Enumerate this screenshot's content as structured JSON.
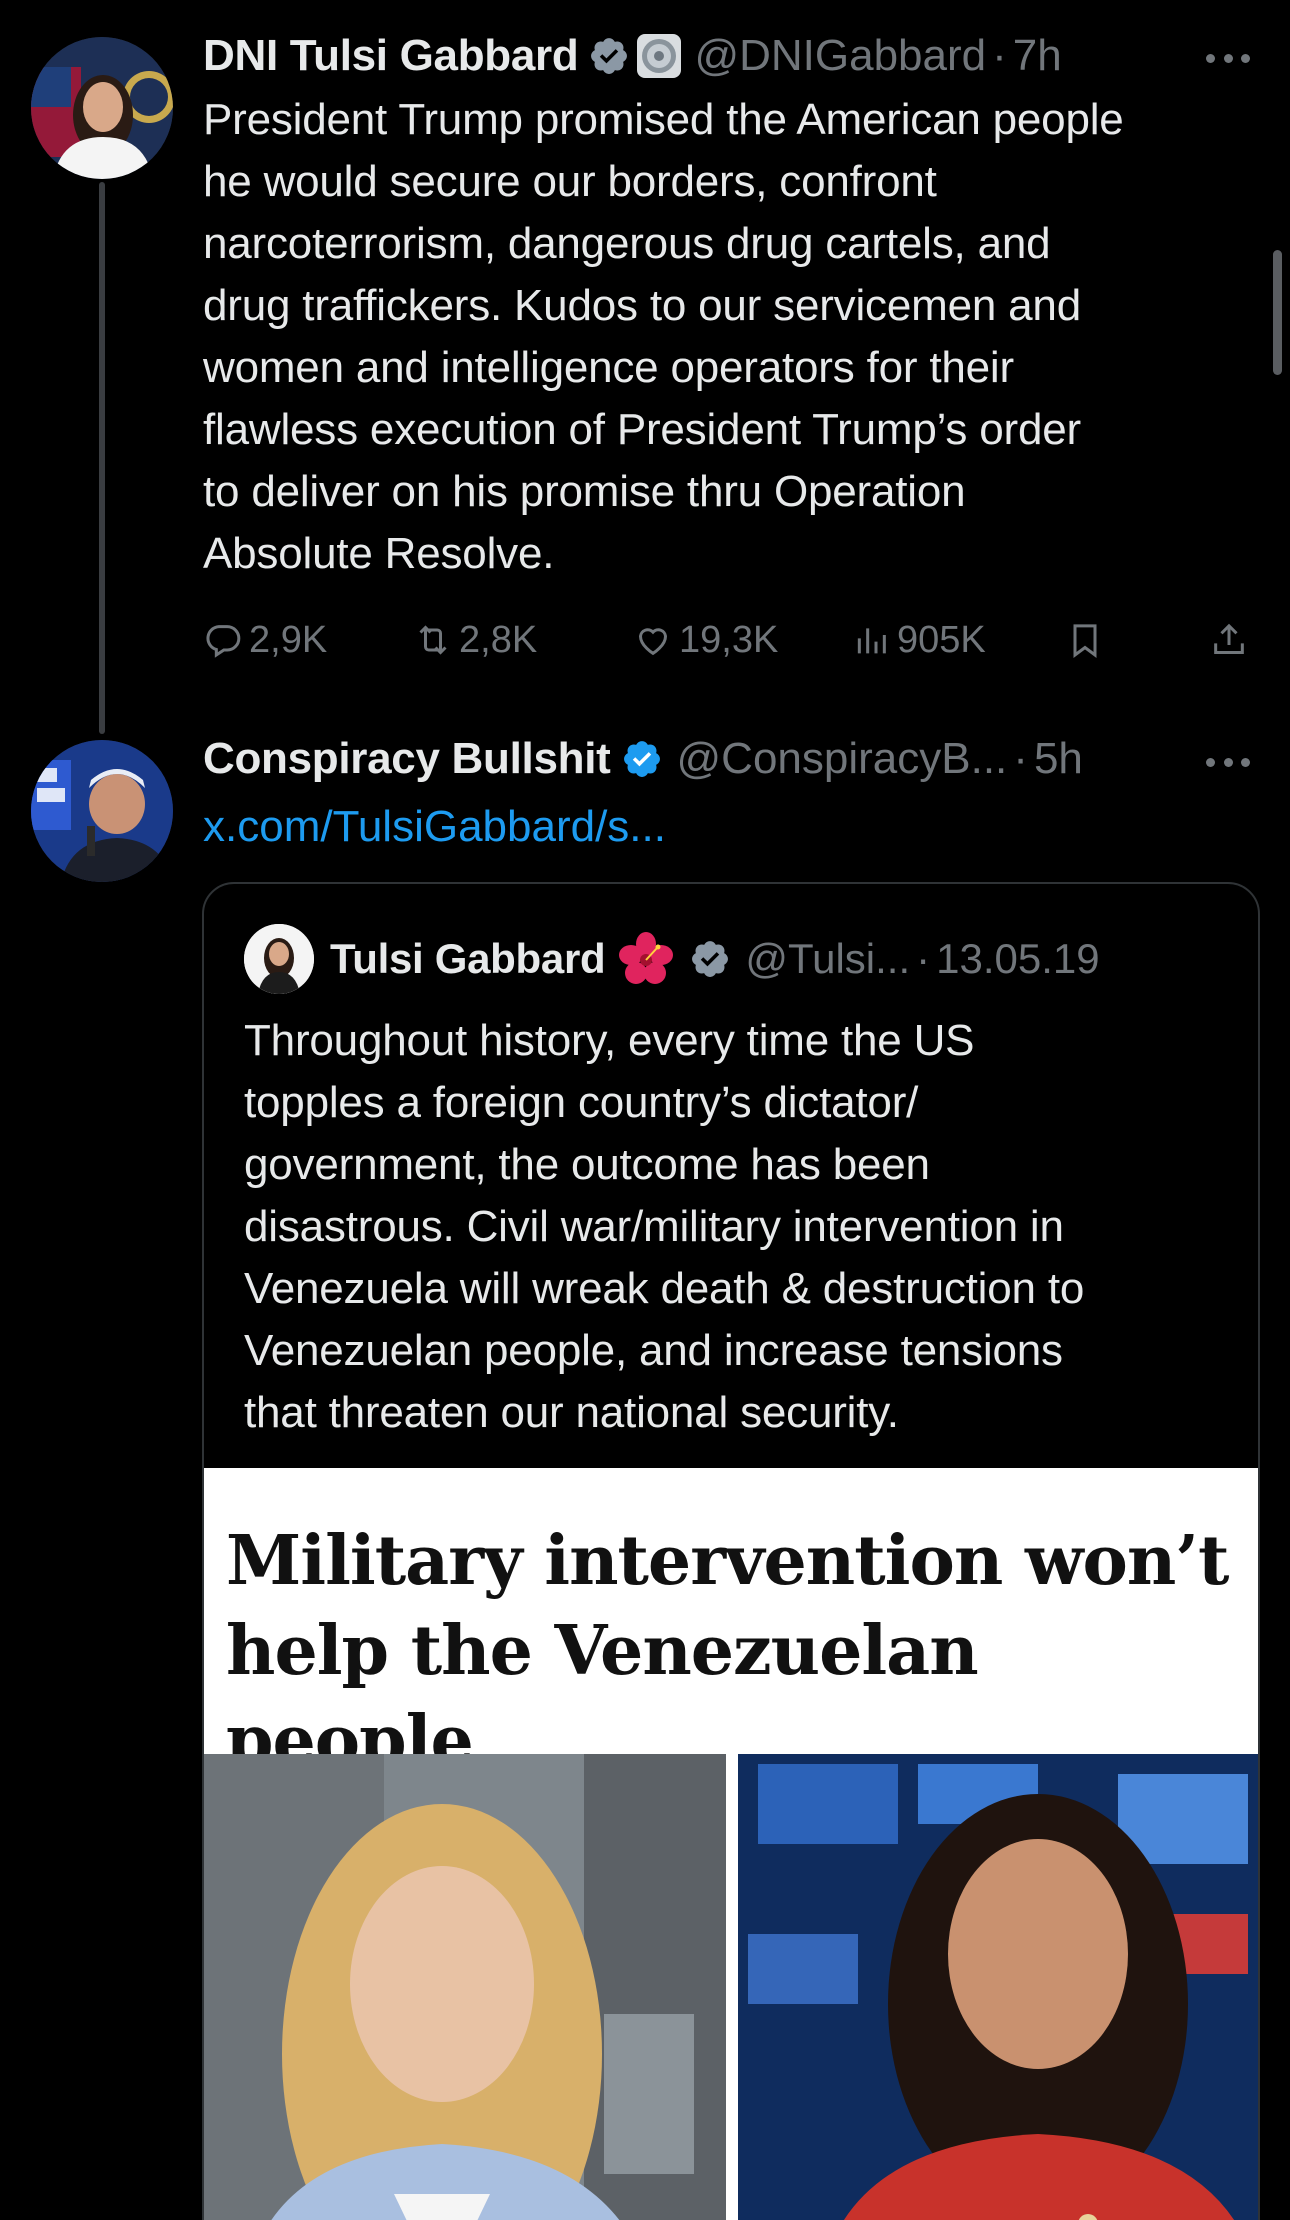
{
  "tweet1": {
    "display_name": "DNI Tulsi Gabbard",
    "handle": "@DNIGabbard",
    "separator": "·",
    "time": "7h",
    "text": "President Trump promised the American people\nhe would secure our borders, confront\nnarcoterrorism, dangerous drug cartels, and\ndrug traffickers. Kudos to our servicemen and\nwomen and intelligence operators for their\nflawless execution of President Trump’s order\nto deliver on his promise thru Operation\nAbsolute Resolve.",
    "actions": {
      "replies": "2,9K",
      "reposts": "2,8K",
      "likes": "19,3K",
      "views": "905K"
    },
    "verified_badge_color": "#8b98a5"
  },
  "tweet2": {
    "display_name": "Conspiracy Bullshit",
    "handle": "@ConspiracyB...",
    "separator": "·",
    "time": "5h",
    "link": "x.com/TulsiGabbard/s...",
    "verified_badge_color": "#1d9bf0"
  },
  "quote": {
    "display_name": "Tulsi Gabbard",
    "handle": "@Tulsi...",
    "separator": "·",
    "date": "13.05.19",
    "text": "Throughout history, every time the US\ntopples a foreign country’s dictator/\ngovernment, the outcome has been\ndisastrous. Civil war/military intervention in\nVenezuela will wreak death & destruction to\nVenezuelan people, and increase tensions\nthat threaten our national security.",
    "verified_badge_color": "#8b98a5",
    "article_headline": "Military intervention won’t\nhelp the Venezuelan people",
    "icons": [
      "hibiscus-icon"
    ]
  },
  "colors": {
    "background": "#000000",
    "text": "#e7e9ea",
    "muted": "#71767b",
    "link": "#1d9bf0"
  }
}
